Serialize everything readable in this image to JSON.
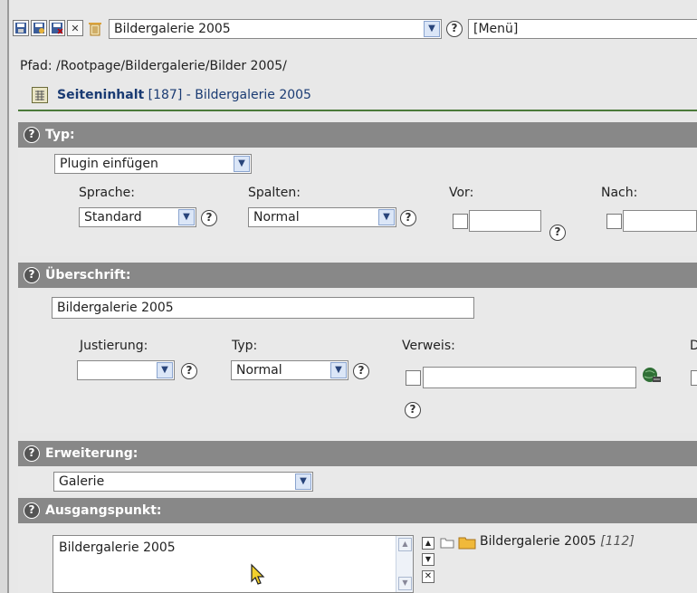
{
  "toolbar": {
    "icons": [
      "save-icon",
      "save-view-icon",
      "save-close-icon",
      "close-icon",
      "delete-icon"
    ],
    "page_select_value": "Bildergalerie 2005",
    "menu_select_value": "[Menü]"
  },
  "path": "Pfad: /Rootpage/Bildergalerie/Bilder 2005/",
  "record": {
    "title_bold": "Seiteninhalt",
    "title_rest": " [187] - Bildergalerie 2005"
  },
  "typ_section": {
    "header": "Typ:",
    "type_value": "Plugin einfügen",
    "sprache_label": "Sprache:",
    "sprache_value": "Standard",
    "spalten_label": "Spalten:",
    "spalten_value": "Normal",
    "vor_label": "Vor:",
    "nach_label": "Nach:"
  },
  "header_section": {
    "header": "Überschrift:",
    "heading_value": "Bildergalerie 2005",
    "justierung_label": "Justierung:",
    "justierung_value": "",
    "typ_label": "Typ:",
    "typ_value": "Normal",
    "verweis_label": "Verweis:",
    "cutoff_label": "D"
  },
  "erweiterung_section": {
    "header": "Erweiterung:",
    "value": "Galerie"
  },
  "ausgangspunkt_section": {
    "header": "Ausgangspunkt:",
    "list_item": "Bildergalerie 2005",
    "tree_item_label": "Bildergalerie 2005",
    "tree_item_id": "[112]"
  },
  "colors": {
    "section_header_bg": "#888888",
    "separator_green": "#4c7a3a",
    "title_blue": "#1a3b73"
  }
}
